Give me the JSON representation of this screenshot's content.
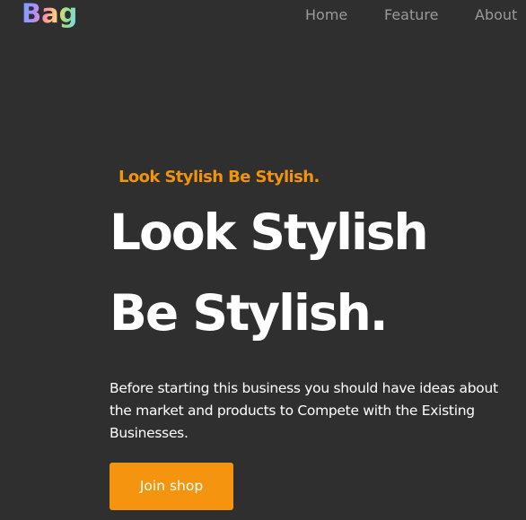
{
  "brand": {
    "logo_text": "Bag"
  },
  "nav": {
    "items": [
      {
        "label": "Home"
      },
      {
        "label": "Feature"
      },
      {
        "label": "About"
      }
    ]
  },
  "hero": {
    "tagline": "Look Stylish Be Stylish.",
    "headline_line1": "Look Stylish",
    "headline_line2": "Be Stylish.",
    "description": "Before starting this business you should have ideas about the market and products to Compete with the Existing Businesses.",
    "cta_label": "Join shop"
  },
  "colors": {
    "background": "#2f2f2f",
    "accent": "#f5950f",
    "nav_text": "#9a9a9a",
    "heading_text": "#ffffff"
  }
}
